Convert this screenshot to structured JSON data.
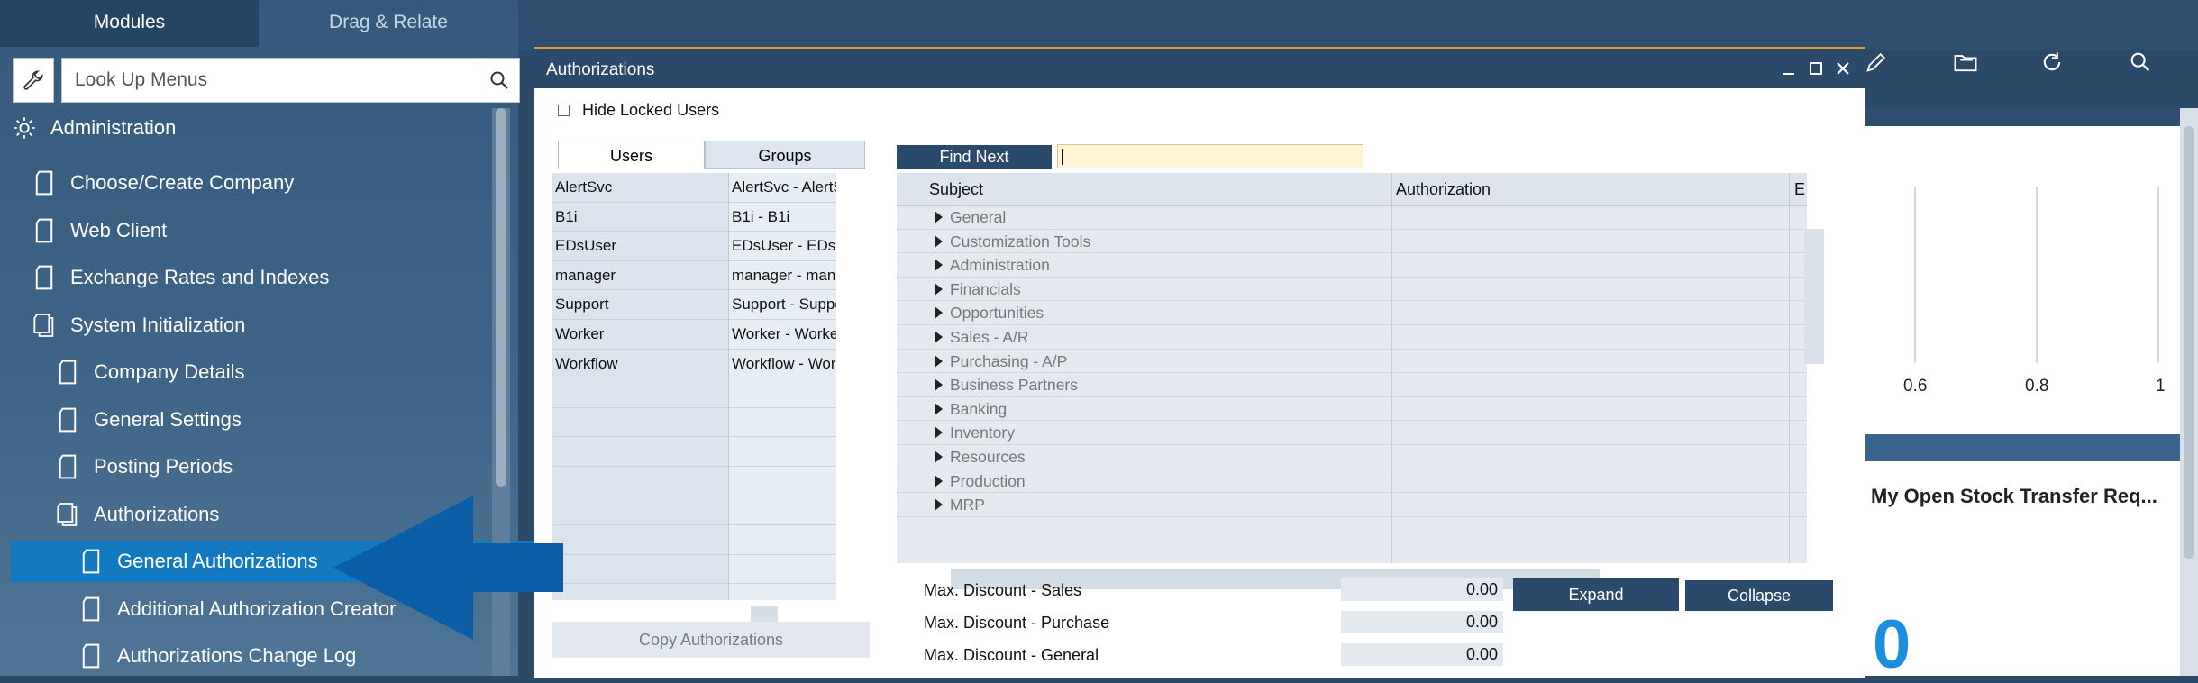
{
  "modules_panel": {
    "tabs": [
      "Modules",
      "Drag & Relate"
    ],
    "search": {
      "placeholder": "Look Up Menus"
    },
    "items": [
      {
        "label": "Administration",
        "icon": "administration-gear-icon"
      },
      {
        "label": "Choose/Create Company",
        "icon": "document-icon"
      },
      {
        "label": "Web Client",
        "icon": "document-icon"
      },
      {
        "label": "Exchange Rates and Indexes",
        "icon": "document-icon"
      },
      {
        "label": "System Initialization",
        "icon": "folder-open-icon"
      },
      {
        "label": "Company Details",
        "icon": "document-icon"
      },
      {
        "label": "General Settings",
        "icon": "document-icon"
      },
      {
        "label": "Posting Periods",
        "icon": "document-icon"
      },
      {
        "label": "Authorizations",
        "icon": "folder-open-icon"
      },
      {
        "label": "General Authorizations",
        "icon": "document-icon",
        "selected": true
      },
      {
        "label": "Additional Authorization Creator",
        "icon": "document-icon"
      },
      {
        "label": "Authorizations Change Log",
        "icon": "document-icon"
      }
    ]
  },
  "auth_window": {
    "title": "Authorizations",
    "hide_locked_label": "Hide Locked Users",
    "tabs": [
      "Users",
      "Groups"
    ],
    "users": [
      {
        "code": "AlertSvc",
        "name": "AlertSvc - AlertS"
      },
      {
        "code": "B1i",
        "name": "B1i - B1i"
      },
      {
        "code": "EDsUser",
        "name": "EDsUser - EDsU"
      },
      {
        "code": "manager",
        "name": "manager - mana"
      },
      {
        "code": "Support",
        "name": "Support - Suppo"
      },
      {
        "code": "Worker",
        "name": "Worker - Worke"
      },
      {
        "code": "Workflow",
        "name": "Workflow - Work"
      }
    ],
    "copy_button": "Copy Authorizations",
    "find_next_button": "Find Next",
    "columns": {
      "subject": "Subject",
      "authorization": "Authorization",
      "extra": "E"
    },
    "subjects": [
      "General",
      "Customization Tools",
      "Administration",
      "Financials",
      "Opportunities",
      "Sales - A/R",
      "Purchasing - A/P",
      "Business Partners",
      "Banking",
      "Inventory",
      "Resources",
      "Production",
      "MRP"
    ],
    "discounts": [
      {
        "label": "Max. Discount - Sales",
        "value": "0.00"
      },
      {
        "label": "Max. Discount - Purchase",
        "value": "0.00"
      },
      {
        "label": "Max. Discount - General",
        "value": "0.00"
      }
    ],
    "expand_button": "Expand",
    "collapse_button": "Collapse"
  },
  "right_panel": {
    "toolbar_icons": [
      "pencil-icon",
      "folder-icon",
      "refresh-icon",
      "search-icon"
    ],
    "ticks": [
      "0.6",
      "0.8",
      "1"
    ],
    "widget_title": "My Open Stock Transfer Req...",
    "widget_value": "0"
  },
  "colors": {
    "selected_item": "#1379c0",
    "title_bar": "#2a4a6b",
    "accent_value": "#1b8fde"
  }
}
